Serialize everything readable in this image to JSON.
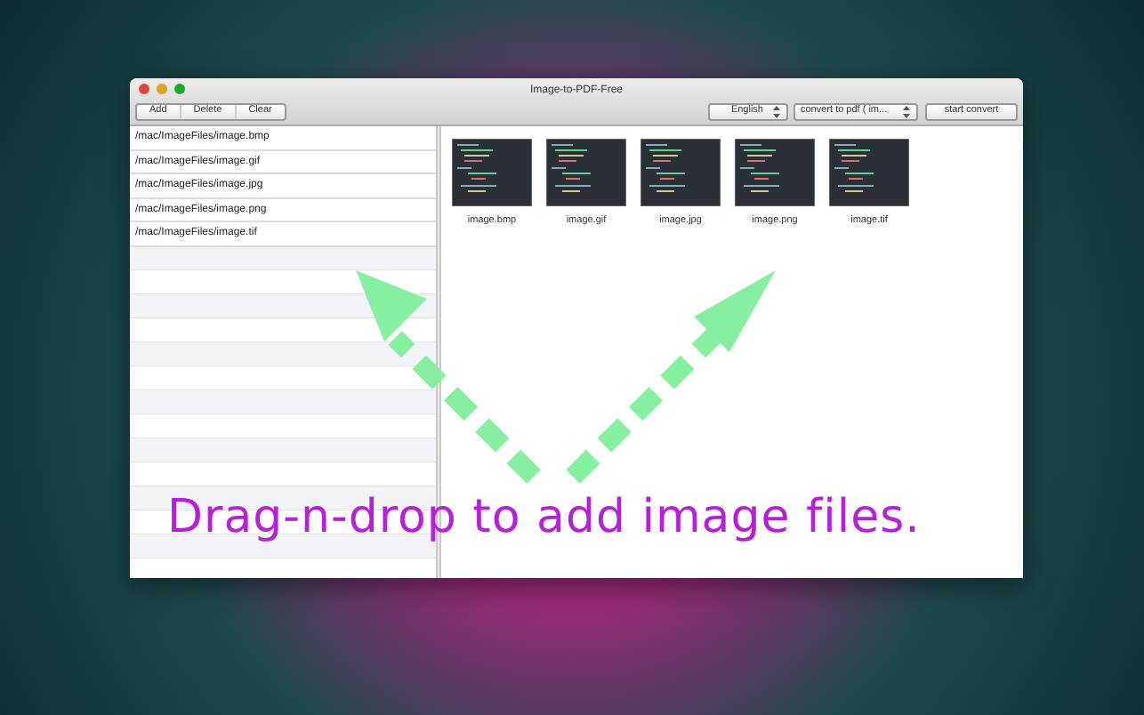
{
  "window": {
    "title": "Image-to-PDF-Free"
  },
  "toolbar": {
    "buttons": [
      "Add",
      "Delete",
      "Clear"
    ],
    "language": "English",
    "format": "convert to pdf ( im...",
    "start_button": "start convert"
  },
  "file_list": [
    "/mac/ImageFiles/image.bmp",
    "/mac/ImageFiles/image.gif",
    "/mac/ImageFiles/image.jpg",
    "/mac/ImageFiles/image.png",
    "/mac/ImageFiles/image.tif"
  ],
  "thumbnails": [
    "image.bmp",
    "image.gif",
    "image.jpg",
    "image.png",
    "image.tif"
  ],
  "overlay_caption": "Drag-n-drop to add image files."
}
